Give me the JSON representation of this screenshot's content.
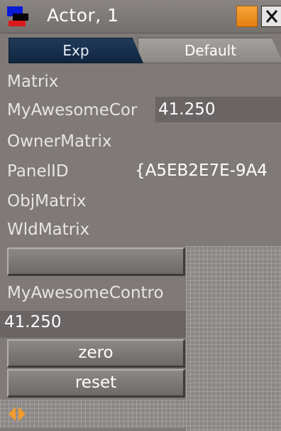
{
  "window": {
    "title": "Actor, 1",
    "icons": {
      "app": "actor-app-icon",
      "minimize": "orange-square-button",
      "close": "close-x-icon"
    }
  },
  "tabs": [
    {
      "label": "Exp",
      "active": true
    },
    {
      "label": "Default",
      "active": false
    }
  ],
  "properties": [
    {
      "label": "Matrix",
      "value": ""
    },
    {
      "label": "MyAwesomeCor",
      "value": "41.250"
    },
    {
      "label": "OwnerMatrix",
      "value": ""
    },
    {
      "label": "PanelID",
      "value": "{A5EB2E7E-9A4"
    },
    {
      "label": "ObjMatrix",
      "value": ""
    },
    {
      "label": "WldMatrix",
      "value": ""
    }
  ],
  "control": {
    "empty_button_label": "",
    "label": "MyAwesomeContro",
    "value": "41.250",
    "zero_label": "zero",
    "reset_label": "reset"
  },
  "colors": {
    "panel_bg": "#7f7a77",
    "active_tab": "#1a3150",
    "accent_orange": "#f29a2c",
    "icon_blue": "#0a1bd6",
    "icon_red": "#d9191b"
  },
  "footer": {
    "icon": "resize-arrows-icon"
  }
}
